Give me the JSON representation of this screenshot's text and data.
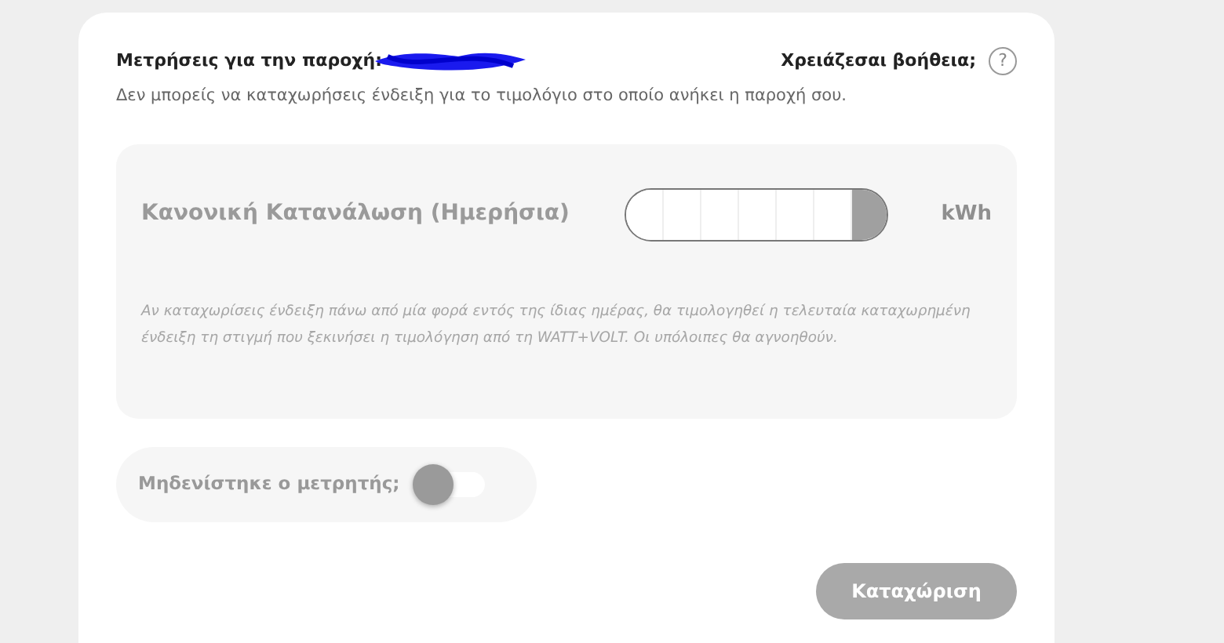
{
  "header": {
    "title": "Μετρήσεις για την παροχή:",
    "redacted": true,
    "help_label": "Χρειάζεσαι βοήθεια;",
    "help_icon": "?"
  },
  "notice": "Δεν μπορείς να καταχωρήσεις ένδειξη για το τιμολόγιο στο οποίο ανήκει η παροχή σου.",
  "readings": [
    {
      "label": "Κανονική Κατανάλωση (Ημερήσια)",
      "disabled": true,
      "unit": "kWh"
    }
  ],
  "note": "Αν καταχωρίσεις ένδειξη πάνω από μία φορά εντός της ίδιας ημέρας, θα τιμολογηθεί η τελευταία καταχωρημένη ένδειξη τη στιγμή που ξεκινήσει η τιμολόγηση από τη WATT+VOLT. Οι υπόλοιπες θα αγνοηθούν.",
  "reset_toggle": {
    "label": "Μηδενίστηκε ο μετρητής;",
    "on": false
  },
  "submit": {
    "label": "Καταχώριση",
    "disabled": true
  }
}
